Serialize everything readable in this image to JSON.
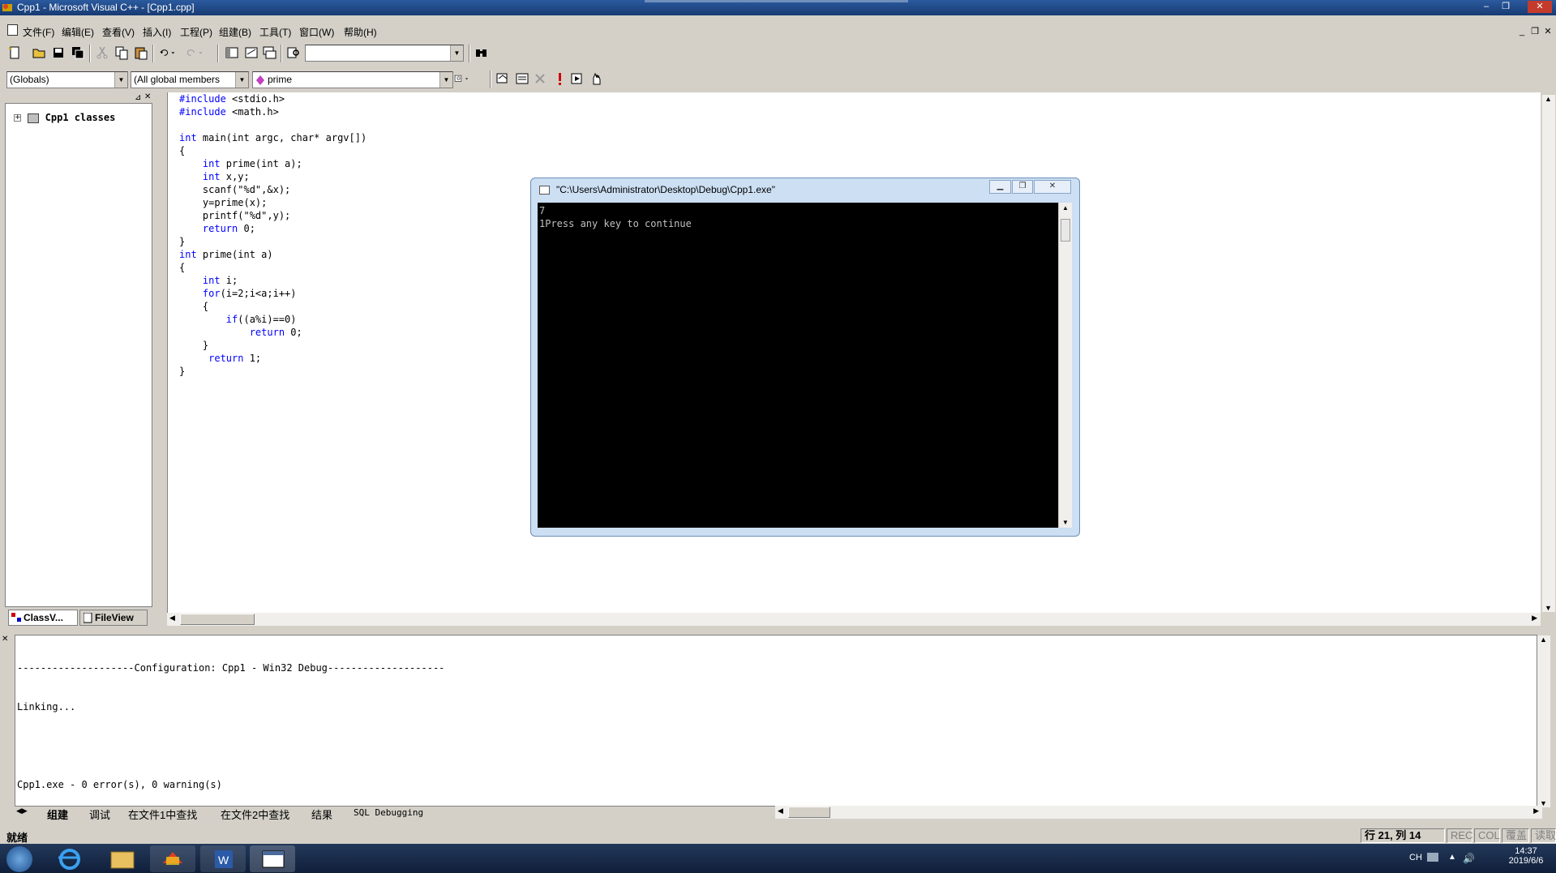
{
  "window": {
    "title": "Cpp1 - Microsoft Visual C++ - [Cpp1.cpp]",
    "controls": [
      "–",
      "❐",
      "✕"
    ]
  },
  "menu": {
    "items": [
      "文件(F)",
      "编辑(E)",
      "查看(V)",
      "插入(I)",
      "工程(P)",
      "组建(B)",
      "工具(T)",
      "窗口(W)",
      "帮助(H)"
    ]
  },
  "toolbar": {
    "find_combo": "",
    "globals_combo": "(Globals)",
    "members_combo": "(All global members",
    "function_combo": "prime"
  },
  "workspace": {
    "tree_root": "Cpp1 classes",
    "tabs": [
      "ClassV...",
      "FileView"
    ]
  },
  "editor": {
    "lines": [
      {
        "kw": "#include",
        "rest": " <stdio.h>"
      },
      {
        "kw": "#include",
        "rest": " <math.h>"
      },
      {
        "kw": "",
        "rest": ""
      },
      {
        "kw": "int",
        "rest": " main(int argc, char* argv[])"
      },
      {
        "kw": "",
        "rest": "{"
      },
      {
        "kw": "    int",
        "rest": " prime(int a);"
      },
      {
        "kw": "    int",
        "rest": " x,y;"
      },
      {
        "kw": "",
        "rest": "    scanf(\"%d\",&x);"
      },
      {
        "kw": "",
        "rest": "    y=prime(x);"
      },
      {
        "kw": "",
        "rest": "    printf(\"%d\",y);"
      },
      {
        "kw": "    return",
        "rest": " 0;"
      },
      {
        "kw": "",
        "rest": "}"
      },
      {
        "kw": "int",
        "rest": " prime(int a)"
      },
      {
        "kw": "",
        "rest": "{"
      },
      {
        "kw": "    int",
        "rest": " i;"
      },
      {
        "kw": "    for",
        "rest": "(i=2;i<a;i++)"
      },
      {
        "kw": "",
        "rest": "    {"
      },
      {
        "kw": "        if",
        "rest": "((a%i)==0)"
      },
      {
        "kw": "            return",
        "rest": " 0;"
      },
      {
        "kw": "",
        "rest": "    }"
      },
      {
        "kw": "     return",
        "rest": " 1;"
      },
      {
        "kw": "",
        "rest": "}"
      }
    ]
  },
  "console": {
    "title": "\"C:\\Users\\Administrator\\Desktop\\Debug\\Cpp1.exe\"",
    "lines": [
      "7",
      "1Press any key to continue"
    ]
  },
  "output": {
    "lines": [
      "--------------------Configuration: Cpp1 - Win32 Debug--------------------",
      "Linking...",
      "",
      "Cpp1.exe - 0 error(s), 0 warning(s)"
    ],
    "tabs": [
      "组建",
      "调试",
      "在文件1中查找",
      "在文件2中查找",
      "结果",
      "SQL Debugging"
    ]
  },
  "status": {
    "ready": "就绪",
    "position": "行 21, 列 14",
    "indicators": [
      "REC",
      "COL",
      "覆盖",
      "读取"
    ]
  },
  "taskbar": {
    "lang": "CH",
    "time": "14:37",
    "date": "2019/6/6"
  },
  "colors": {
    "keyword": "#0000ff",
    "titlebar": "#2b5a9e",
    "console_bg": "#000000"
  }
}
